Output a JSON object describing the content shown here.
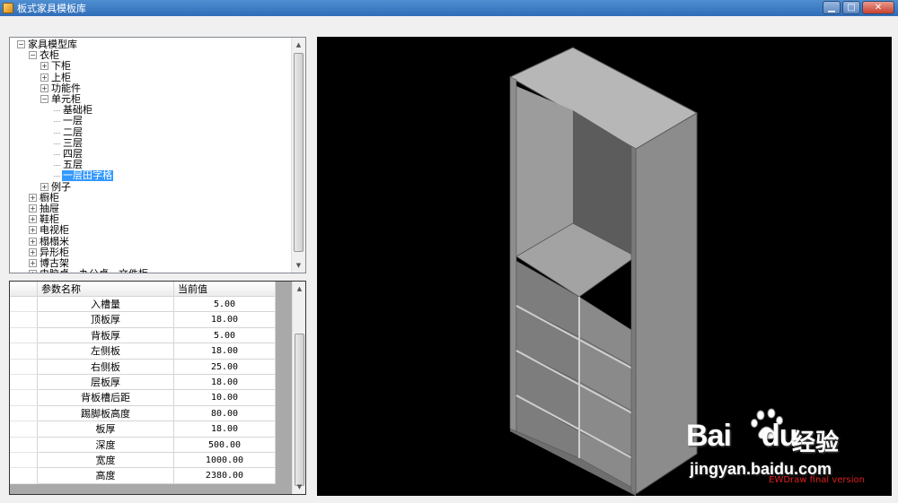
{
  "window": {
    "title": "板式家具模板库",
    "min_glyph": "▁",
    "max_glyph": "□",
    "close_glyph": "✕"
  },
  "tree": {
    "nodes": [
      {
        "label": "家具模型库",
        "level": 0,
        "expander": "−"
      },
      {
        "label": "衣柜",
        "level": 1,
        "expander": "−"
      },
      {
        "label": "下柜",
        "level": 2,
        "expander": "+"
      },
      {
        "label": "上柜",
        "level": 2,
        "expander": "+"
      },
      {
        "label": "功能件",
        "level": 2,
        "expander": "+"
      },
      {
        "label": "单元柜",
        "level": 2,
        "expander": "−"
      },
      {
        "label": "基础柜",
        "level": 3,
        "expander": ""
      },
      {
        "label": "一层",
        "level": 3,
        "expander": ""
      },
      {
        "label": "二层",
        "level": 3,
        "expander": ""
      },
      {
        "label": "三层",
        "level": 3,
        "expander": ""
      },
      {
        "label": "四层",
        "level": 3,
        "expander": ""
      },
      {
        "label": "五层",
        "level": 3,
        "expander": ""
      },
      {
        "label": "一层田字格",
        "level": 3,
        "expander": "",
        "selected": true
      },
      {
        "label": "例子",
        "level": 2,
        "expander": "+"
      },
      {
        "label": "橱柜",
        "level": 1,
        "expander": "+"
      },
      {
        "label": "抽屉",
        "level": 1,
        "expander": "+"
      },
      {
        "label": "鞋柜",
        "level": 1,
        "expander": "+"
      },
      {
        "label": "电视柜",
        "level": 1,
        "expander": "+"
      },
      {
        "label": "榻榻米",
        "level": 1,
        "expander": "+"
      },
      {
        "label": "异形柜",
        "level": 1,
        "expander": "+"
      },
      {
        "label": "博古架",
        "level": 1,
        "expander": "+"
      },
      {
        "label": "电脑桌、办公桌、文件柜",
        "level": 1,
        "expander": "+"
      }
    ]
  },
  "grid": {
    "headers": {
      "name": "参数名称",
      "value": "当前值"
    },
    "rows": [
      {
        "name": "入槽量",
        "value": "5.00"
      },
      {
        "name": "顶板厚",
        "value": "18.00"
      },
      {
        "name": "背板厚",
        "value": "5.00"
      },
      {
        "name": "左侧板",
        "value": "18.00"
      },
      {
        "name": "右侧板",
        "value": "25.00"
      },
      {
        "name": "层板厚",
        "value": "18.00"
      },
      {
        "name": "背板槽后距",
        "value": "10.00"
      },
      {
        "name": "踢脚板高度",
        "value": "80.00"
      },
      {
        "name": "板厚",
        "value": "18.00"
      },
      {
        "name": "深度",
        "value": "500.00"
      },
      {
        "name": "宽度",
        "value": "1000.00"
      },
      {
        "name": "高度",
        "value": "2380.00"
      }
    ]
  },
  "viewport": {
    "watermark": "EWDraw final version",
    "background": "#000000"
  },
  "overlay": {
    "brand": "Bai",
    "brand_tail": "du",
    "brand_cn": "经验",
    "url": "jingyan.baidu.com"
  },
  "colors": {
    "selection": "#3399ff",
    "titlebar": "#2f6db8",
    "watermark": "#e01e1e"
  }
}
